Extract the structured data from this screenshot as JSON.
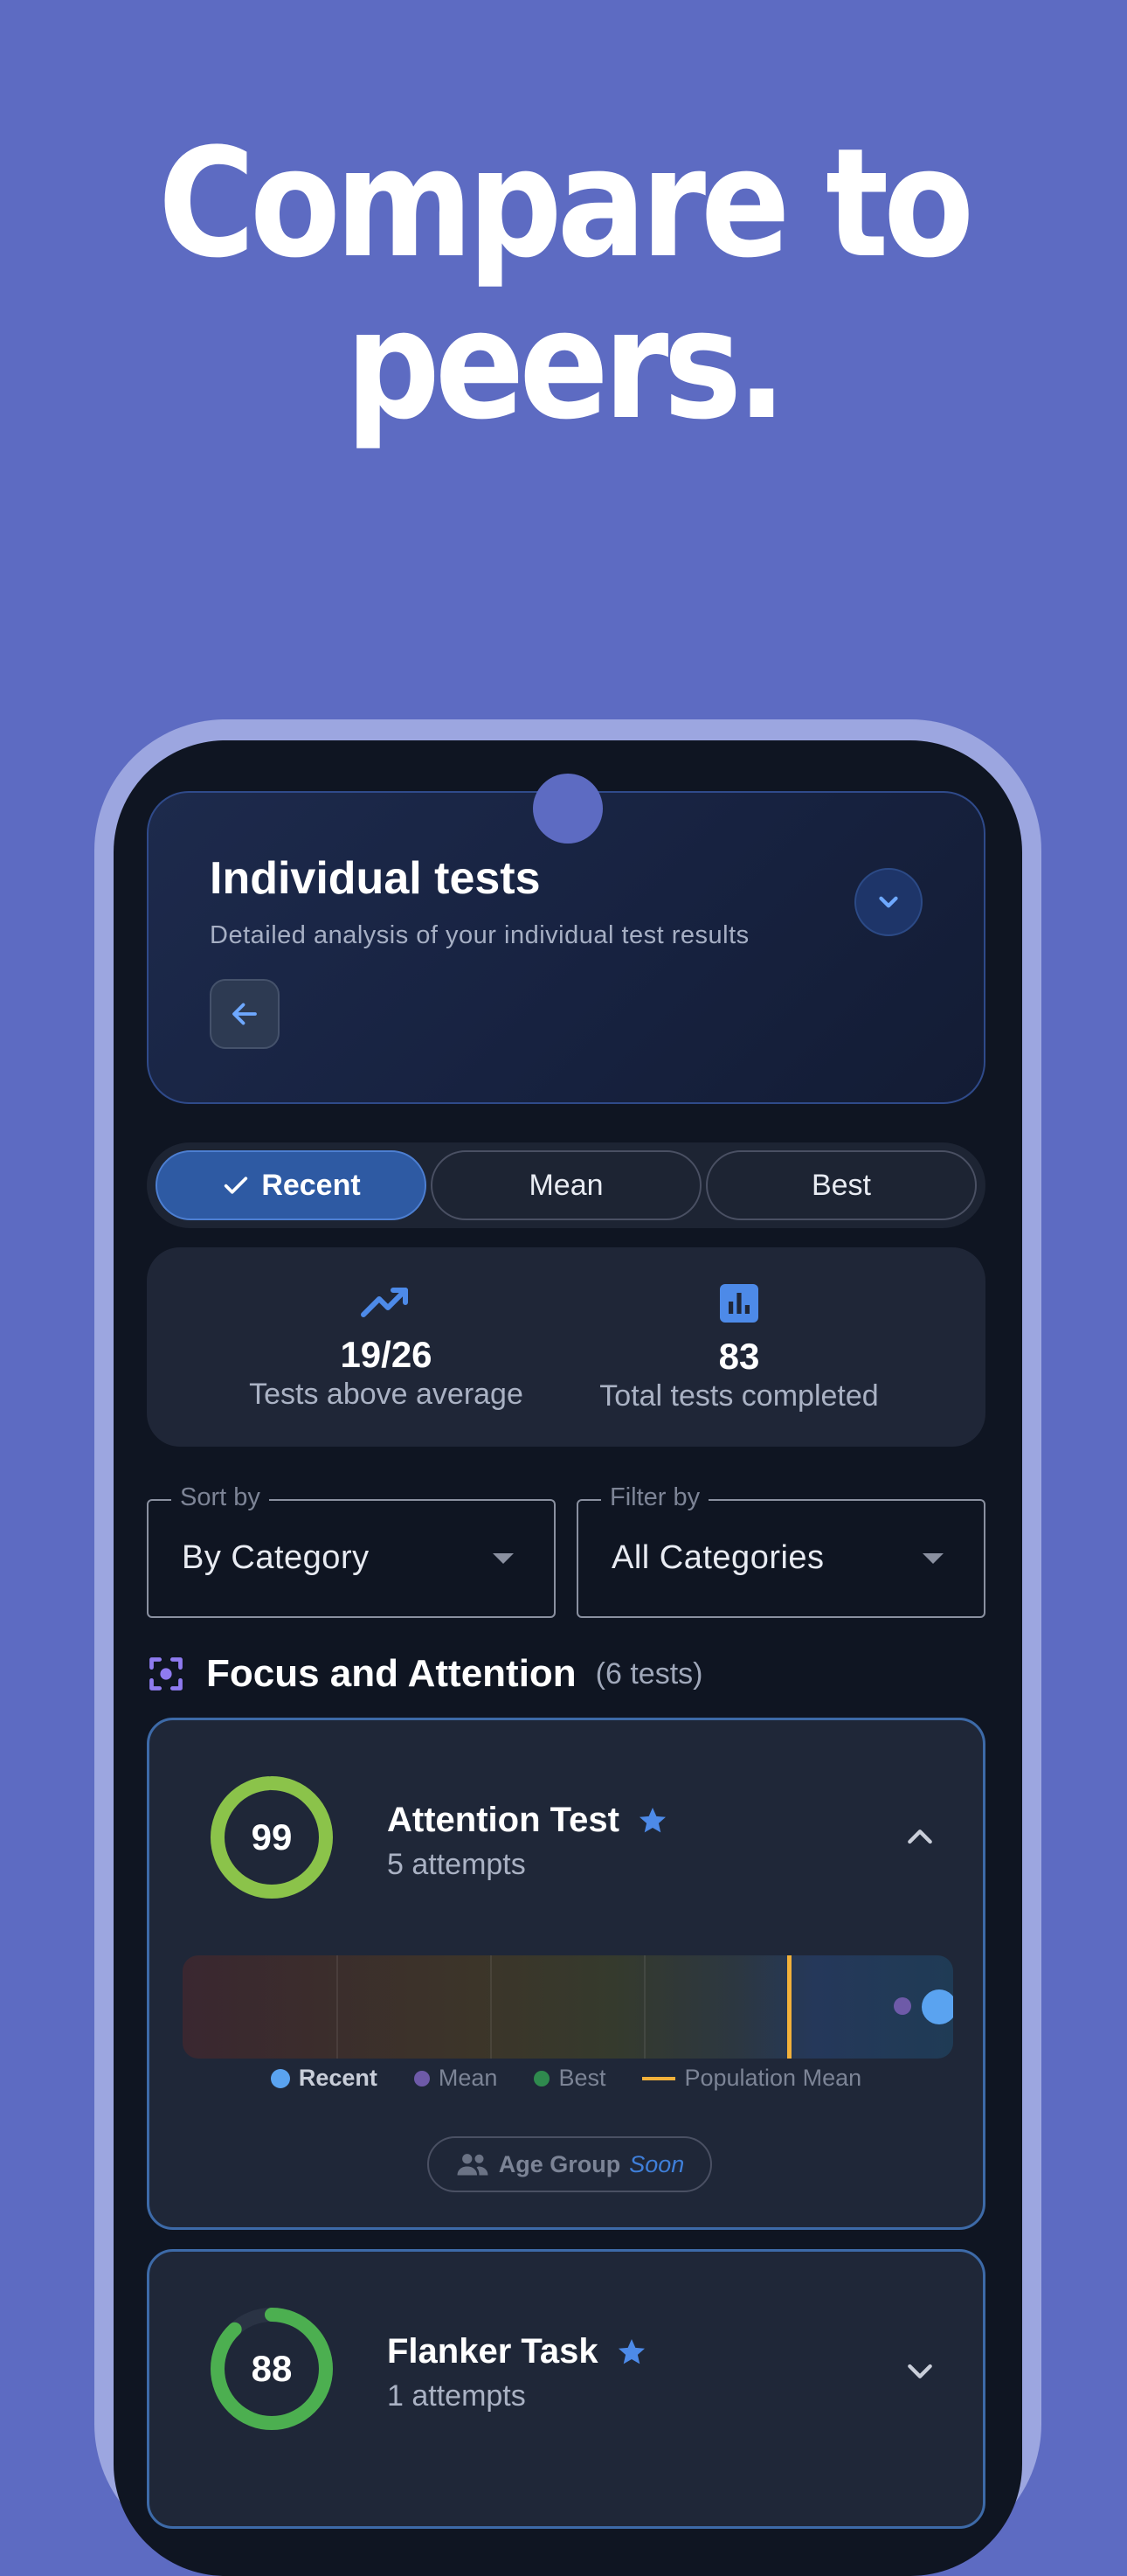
{
  "headline": {
    "line1": "Compare to",
    "line2": "peers."
  },
  "header": {
    "title": "Individual tests",
    "subtitle": "Detailed analysis of your individual test results"
  },
  "segments": [
    {
      "label": "Recent",
      "selected": true
    },
    {
      "label": "Mean",
      "selected": false
    },
    {
      "label": "Best",
      "selected": false
    }
  ],
  "stats": {
    "above": {
      "value": "19/26",
      "label": "Tests above average",
      "icon": "trending-up-icon"
    },
    "total": {
      "value": "83",
      "label": "Total tests completed",
      "icon": "bar-chart-icon"
    }
  },
  "sort": {
    "legend": "Sort by",
    "value": "By Category"
  },
  "filter": {
    "legend": "Filter by",
    "value": "All Categories"
  },
  "section": {
    "title": "Focus and Attention",
    "count": "(6 tests)",
    "icon": "focus-icon"
  },
  "cards": [
    {
      "score": "99",
      "score_fraction": 0.99,
      "ring_color": "#8bc34a",
      "title": "Attention Test",
      "attempts": "5 attempts",
      "expanded": true,
      "legend": {
        "recent": "Recent",
        "mean": "Mean",
        "best": "Best",
        "population": "Population Mean"
      },
      "age_group": {
        "label": "Age Group",
        "badge": "Soon"
      }
    },
    {
      "score": "88",
      "score_fraction": 0.88,
      "ring_color": "#4caf50",
      "title": "Flanker Task",
      "attempts": "1 attempts",
      "expanded": false
    }
  ],
  "colors": {
    "background": "#5d6bc2",
    "accent": "#4d8ae8",
    "recent": "#5aa3f0",
    "mean": "#6e5aa8",
    "best": "#2f8a4e",
    "population_mean": "#f2b13a"
  }
}
